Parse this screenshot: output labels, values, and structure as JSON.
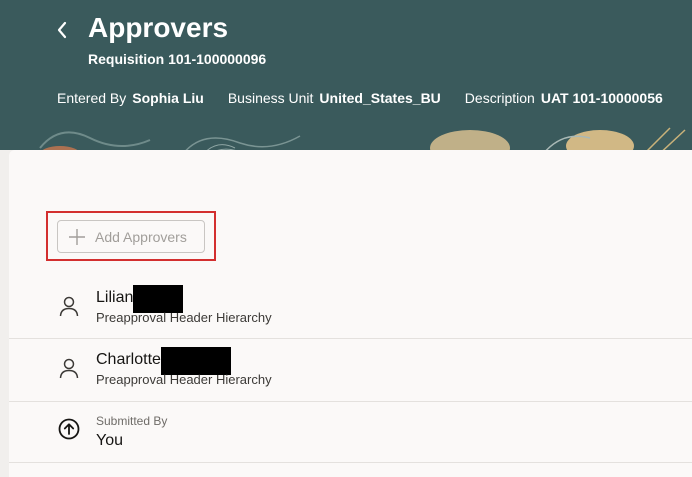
{
  "header": {
    "title": "Approvers",
    "subtitle": "Requisition 101-100000096",
    "meta": [
      {
        "label": "Entered By",
        "value": "Sophia Liu"
      },
      {
        "label": "Business Unit",
        "value": "United_States_BU"
      },
      {
        "label": "Description",
        "value": "UAT 101-10000056"
      }
    ],
    "back_icon": "chevron-left-icon"
  },
  "toolbar": {
    "add_label": "Add Approvers",
    "add_icon": "plus-icon",
    "add_disabled": true,
    "highlight_color": "#d32f2f"
  },
  "approvers": [
    {
      "name": "Lilian",
      "name_redacted": true,
      "role": "Preapproval Header Hierarchy",
      "icon": "person-icon"
    },
    {
      "name": "Charlotte",
      "name_redacted": true,
      "role": "Preapproval Header Hierarchy",
      "icon": "person-icon"
    }
  ],
  "submitted": {
    "label": "Submitted By",
    "value": "You",
    "icon": "arrow-up-circle-icon"
  },
  "colors": {
    "header_bg": "#3a5a5c",
    "card_bg": "#fbf9f8"
  }
}
